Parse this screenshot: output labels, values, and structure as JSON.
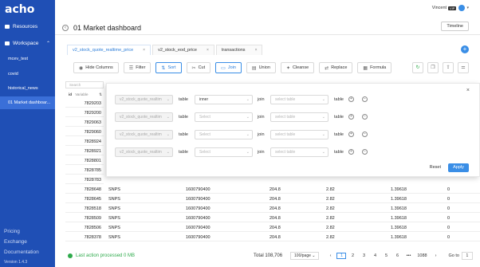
{
  "sidebar": {
    "logo": "acho",
    "items": [
      {
        "label": "Resources",
        "icon": "folder-icon"
      },
      {
        "label": "Workspace",
        "icon": "workspace-icon"
      }
    ],
    "workspace_items": [
      "mcev_test",
      "covid",
      "historical_news",
      "01 Market dashboar..."
    ],
    "footer_links": [
      "Pricing",
      "Exchange",
      "Documentation"
    ],
    "version": "Version 1.4.3"
  },
  "header": {
    "user_name": "Vincent",
    "vip_badge": "VIP",
    "title": "01 Market dashboard",
    "timeline_label": "Timeline"
  },
  "tabs": [
    {
      "label": "v2_stock_quote_realtime_price",
      "active": true
    },
    {
      "label": "v2_stock_eod_price",
      "active": false
    },
    {
      "label": "transactions",
      "active": false
    }
  ],
  "toolbar": [
    "Hide Columns",
    "Filter",
    "Sort",
    "Cut",
    "Join",
    "Union",
    "Cleanse",
    "Replace",
    "Formula"
  ],
  "grid": {
    "search_placeholder": "Search",
    "id_column": "id",
    "id_type": "Variable",
    "top_ids": [
      "7829203",
      "7829200",
      "7829063",
      "7829060",
      "7828924",
      "7828921",
      "7828801",
      "7828785",
      "7828783"
    ],
    "rows": [
      {
        "id": "7828648",
        "sym": "SNPS",
        "ts": "1600790400",
        "a": "204.8",
        "b": "2.82",
        "c": "1.39618",
        "d": "0"
      },
      {
        "id": "7828645",
        "sym": "SNPS",
        "ts": "1600790400",
        "a": "204.8",
        "b": "2.82",
        "c": "1.39618",
        "d": "0"
      },
      {
        "id": "7828518",
        "sym": "SNPS",
        "ts": "1600790400",
        "a": "204.8",
        "b": "2.82",
        "c": "1.39618",
        "d": "0"
      },
      {
        "id": "7828509",
        "sym": "SNPS",
        "ts": "1600790400",
        "a": "204.8",
        "b": "2.82",
        "c": "1.39618",
        "d": "0"
      },
      {
        "id": "7828506",
        "sym": "SNPS",
        "ts": "1600790400",
        "a": "204.8",
        "b": "2.82",
        "c": "1.39618",
        "d": "0"
      },
      {
        "id": "7828378",
        "sym": "SNPS",
        "ts": "1600790400",
        "a": "204.8",
        "b": "2.82",
        "c": "1.39618",
        "d": "0"
      }
    ]
  },
  "join": {
    "rows": [
      {
        "left": "v2_stock_quote_realtim",
        "table": "table",
        "type": "inner",
        "join": "join",
        "right": "select table",
        "table2": "table"
      },
      {
        "left": "v2_stock_quote_realtim",
        "table": "table",
        "type": "Select",
        "join": "join",
        "right": "select table",
        "table2": "table"
      },
      {
        "left": "v2_stock_quote_realtim",
        "table": "table",
        "type": "Select",
        "join": "join",
        "right": "select table",
        "table2": "table"
      },
      {
        "left": "v2_stock_quote_realtim",
        "table": "table",
        "type": "Select",
        "join": "join",
        "right": "select table",
        "table2": "table"
      }
    ],
    "reset_label": "Reset",
    "apply_label": "Apply"
  },
  "status": {
    "message": "Last action processed 0 MB",
    "total": "Total 108,706",
    "page_size": "100/page",
    "pages": [
      "1",
      "2",
      "3",
      "4",
      "5",
      "6",
      "•••",
      "1088"
    ],
    "current_page": "1",
    "goto_label": "Go to",
    "goto_value": "1"
  },
  "colors": {
    "sidebar": "#1f4fb5",
    "accent": "#3a8ee6",
    "success": "#2eaa4b"
  }
}
